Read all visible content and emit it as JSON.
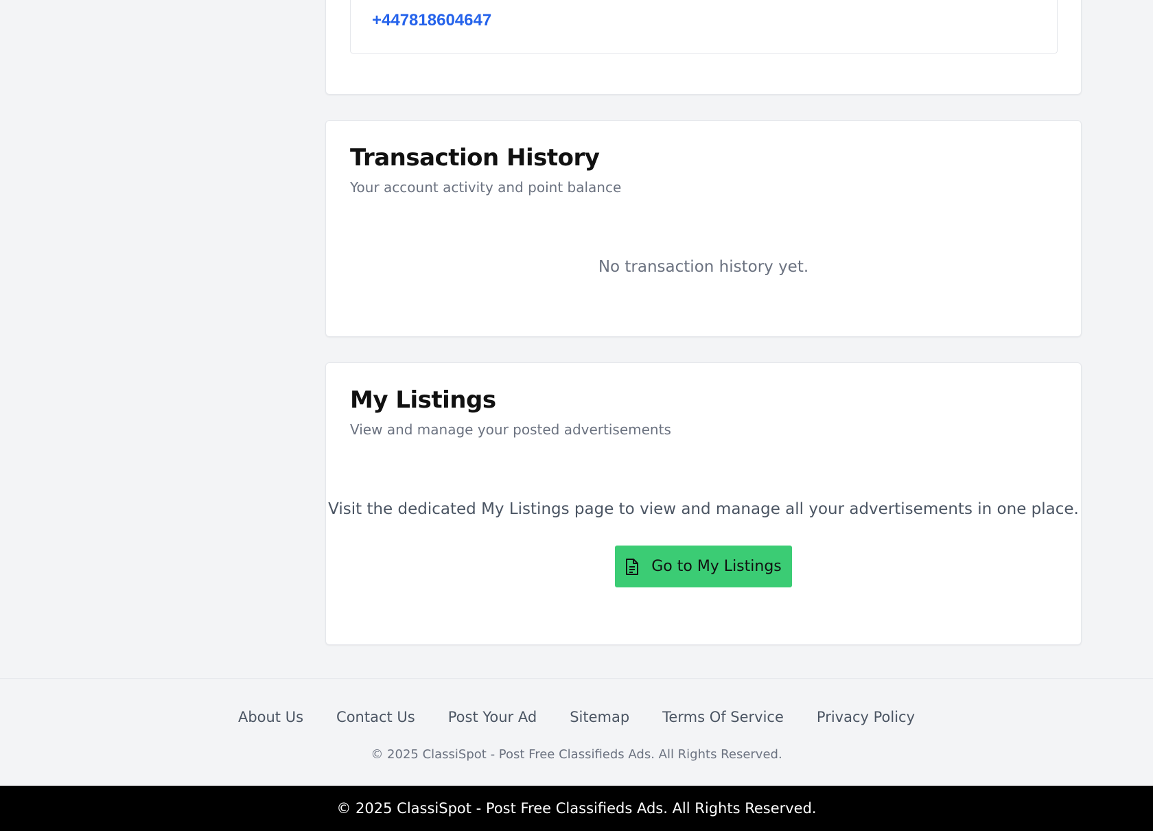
{
  "contact": {
    "phone": "+447818604647"
  },
  "transactions": {
    "title": "Transaction History",
    "subtitle": "Your account activity and point balance",
    "empty_message": "No transaction history yet."
  },
  "listings": {
    "title": "My Listings",
    "subtitle": "View and manage your posted advertisements",
    "message": "Visit the dedicated My Listings page to view and manage all your advertisements in one place.",
    "button_label": "Go to My Listings",
    "button_icon": "document-icon",
    "button_color": "#3bcc74"
  },
  "footer": {
    "links": [
      "About Us",
      "Contact Us",
      "Post Your Ad",
      "Sitemap",
      "Terms Of Service",
      "Privacy Policy"
    ],
    "copyright": "© 2025 ClassiSpot - Post Free Classifieds Ads. All Rights Reserved."
  },
  "bottom_bar": {
    "copyright": "© 2025 ClassiSpot - Post Free Classifieds Ads. All Rights Reserved."
  },
  "colors": {
    "page_background": "#f3f4f6",
    "link_blue": "#2563eb",
    "bottom_bar": "#000000"
  }
}
